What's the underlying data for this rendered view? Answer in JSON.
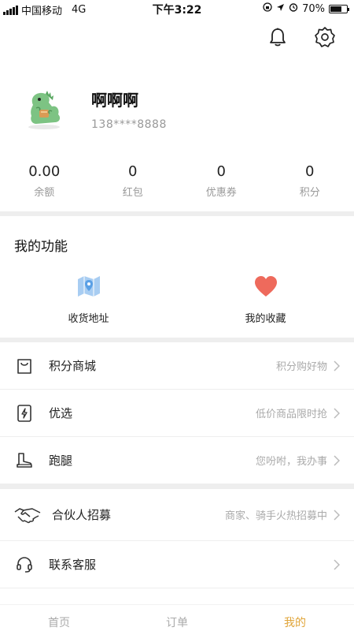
{
  "status_bar": {
    "carrier": "中国移动",
    "network": "4G",
    "time": "下午3:22",
    "battery_percent": "70%",
    "battery_level": 0.7
  },
  "header": {
    "bell_icon": "bell-icon",
    "settings_icon": "gear-icon"
  },
  "profile": {
    "username": "啊啊啊",
    "phone": "138****8888",
    "avatar_icon": "dinosaur-avatar"
  },
  "stats": [
    {
      "value": "0.00",
      "label": "余额"
    },
    {
      "value": "0",
      "label": "红包"
    },
    {
      "value": "0",
      "label": "优惠券"
    },
    {
      "value": "0",
      "label": "积分"
    }
  ],
  "functions": {
    "title": "我的功能",
    "items": [
      {
        "label": "收货地址",
        "icon": "map-icon"
      },
      {
        "label": "我的收藏",
        "icon": "heart-icon"
      }
    ]
  },
  "menu_group_1": [
    {
      "title": "积分商城",
      "hint": "积分购好物",
      "icon": "shopping-bag-icon"
    },
    {
      "title": "优选",
      "hint": "低价商品限时抢",
      "icon": "lightning-icon"
    },
    {
      "title": "跑腿",
      "hint": "您吩咐，我办事",
      "icon": "boot-icon"
    }
  ],
  "menu_group_2": [
    {
      "title": "合伙人招募",
      "hint": "商家、骑手火热招募中",
      "icon": "handshake-icon"
    },
    {
      "title": "联系客服",
      "hint": "",
      "icon": "headset-icon"
    }
  ],
  "tabbar": {
    "tabs": [
      {
        "label": "首页"
      },
      {
        "label": "订单"
      },
      {
        "label": "我的"
      }
    ],
    "active_color": "#e0a53a"
  },
  "colors": {
    "heart": "#ee6a5c",
    "map": "#5aa0e6",
    "section_gap": "#eeeeee"
  }
}
